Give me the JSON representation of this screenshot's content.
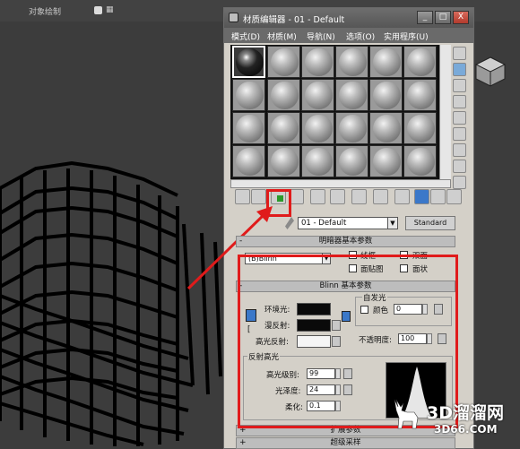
{
  "viewport": {
    "label": "对象绘制",
    "tag": "▦"
  },
  "editor": {
    "title": "材质编辑器 - 01 - Default",
    "window_buttons": [
      "_",
      "□",
      "X"
    ],
    "menu": [
      "模式(D)",
      "材质(M)",
      "导航(N)",
      "选项(O)",
      "实用程序(U)"
    ],
    "material_name": "01 - Default",
    "material_type": "Standard"
  },
  "shader_rollout": {
    "title": "明暗器基本参数",
    "shader": "(B)Blinn",
    "checkboxes": [
      "线框",
      "双面",
      "面贴图",
      "面状"
    ]
  },
  "blinn_rollout": {
    "title": "Blinn 基本参数",
    "ambient": "环境光:",
    "diffuse": "漫反射:",
    "specular": "高光反射:",
    "self_illum_group": "自发光",
    "color_label": "颜色",
    "color_value": "0",
    "opacity_label": "不透明度:",
    "opacity_value": "100",
    "spec_group": "反射高光",
    "spec_level_label": "高光级别:",
    "spec_level_value": "99",
    "gloss_label": "光泽度:",
    "gloss_value": "24",
    "soften_label": "柔化:",
    "soften_value": "0.1"
  },
  "more_rollouts": [
    "扩展参数",
    "超级采样"
  ],
  "watermark": {
    "line1": "3D溜溜网",
    "line2": "3D66.COM"
  }
}
